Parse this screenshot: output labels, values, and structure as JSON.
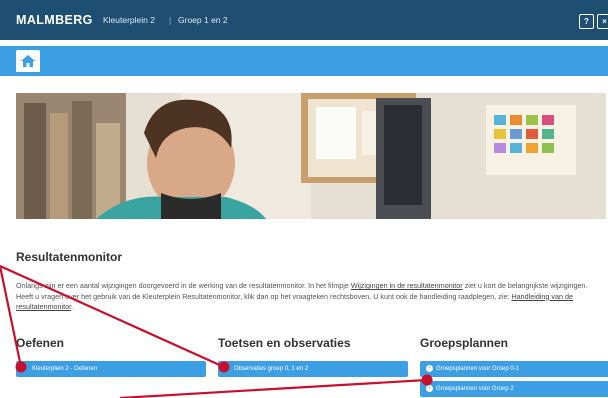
{
  "header": {
    "logo": "MALMBERG",
    "breadcrumb": [
      "Kleuterplein 2",
      "Groep 1 en 2"
    ],
    "separator": "|",
    "help_icon": "?",
    "close_icon": "×"
  },
  "nav": {
    "home_icon": "home-icon"
  },
  "page": {
    "title": "Resultatenmonitor",
    "intro_text_1": "Onlangs zijn er een aantal wijzigingen doorgevoerd in de werking van de resultatenmonitor. In het filmpje ",
    "intro_link_1": "Wijzigingen in de resultatenmonitor",
    "intro_text_2": " ziet u kort de belangrijkste wijzigingen. Heeft u vragen over het gebruik van de Kleuterplein Resultatenmonitor, klik dan op het vraagteken rechtsboven. U kunt ook de handleiding raadplegen, zie: ",
    "intro_link_2": "Handleiding van de resultatenmonitor",
    "intro_text_3": "."
  },
  "columns": {
    "oefenen": {
      "title": "Oefenen",
      "buttons": [
        "Kleuterplein 2 - Oefenen"
      ]
    },
    "toetsen": {
      "title": "Toetsen en observaties",
      "buttons": [
        "Observaties groep 0, 1 en 2"
      ]
    },
    "groepsplannen": {
      "title": "Groepsplannen",
      "buttons": [
        "Groepsplannen voor Groep 0-1",
        "Groepsplannen voor Groep 2"
      ]
    }
  },
  "colors": {
    "header": "#1e4f73",
    "accent": "#3d9fe3",
    "annotation": "#c8102e"
  }
}
